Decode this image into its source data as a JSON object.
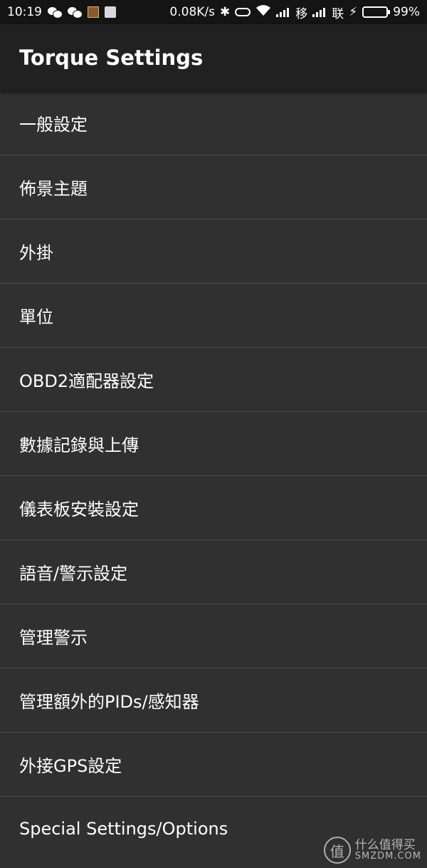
{
  "status_bar": {
    "time": "10:19",
    "net_speed": "0.08K/s",
    "carrier1": "移",
    "carrier2": "联",
    "battery_percent": "99%",
    "battery_level": 0.99,
    "battery_color": "#3cc83c"
  },
  "app_bar": {
    "title": "Torque Settings"
  },
  "settings": {
    "items": [
      {
        "label": "一般設定"
      },
      {
        "label": "佈景主題"
      },
      {
        "label": "外掛"
      },
      {
        "label": "單位"
      },
      {
        "label": "OBD2適配器設定"
      },
      {
        "label": "數據記錄與上傳"
      },
      {
        "label": "儀表板安裝設定"
      },
      {
        "label": "語音/警示設定"
      },
      {
        "label": "管理警示"
      },
      {
        "label": "管理額外的PIDs/感知器"
      },
      {
        "label": "外接GPS設定"
      },
      {
        "label": "Special Settings/Options"
      }
    ]
  },
  "watermark": {
    "badge": "值",
    "text_cn": "什么值得买",
    "text_en": "SMZDM.COM"
  }
}
